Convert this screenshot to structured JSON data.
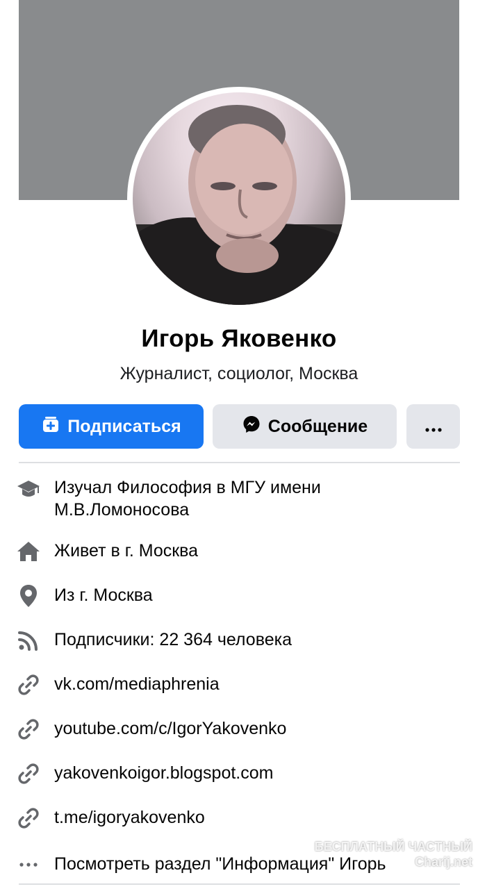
{
  "profile": {
    "name": "Игорь Яковенко",
    "subtitle": "Журналист, социолог, Москва"
  },
  "actions": {
    "follow_label": "Подписаться",
    "message_label": "Сообщение",
    "more_icon": "more-dots-icon"
  },
  "info": [
    {
      "icon": "education-cap-icon",
      "prefix": "Изучал Философия в ",
      "value": "МГУ имени М.В.Ломоносова"
    },
    {
      "icon": "home-icon",
      "prefix": "Живет в г. ",
      "value": "Москва"
    },
    {
      "icon": "location-pin-icon",
      "prefix": "Из г. ",
      "value": "Москва"
    },
    {
      "icon": "rss-followers-icon",
      "prefix": "Подписчики: 22 364 человека",
      "value": ""
    },
    {
      "icon": "link-icon",
      "prefix": "vk.com/mediaphrenia",
      "value": ""
    },
    {
      "icon": "link-icon",
      "prefix": "youtube.com/c/IgorYakovenko",
      "value": ""
    },
    {
      "icon": "link-icon",
      "prefix": "yakovenkoigor.blogspot.com",
      "value": ""
    },
    {
      "icon": "link-icon",
      "prefix": "t.me/igoryakovenko",
      "value": ""
    },
    {
      "icon": "more-dots-icon",
      "prefix": "Посмотреть раздел \"Информация\" Игорь",
      "value": ""
    }
  ],
  "watermark": {
    "line1": "БЕСПЛАТНЫЙ ЧАСТНЫЙ",
    "line2": "Charij.net"
  },
  "colors": {
    "accent": "#1877f2",
    "cover": "#898b8d",
    "button_gray": "#e4e6eb",
    "icon_gray": "#65676b"
  }
}
